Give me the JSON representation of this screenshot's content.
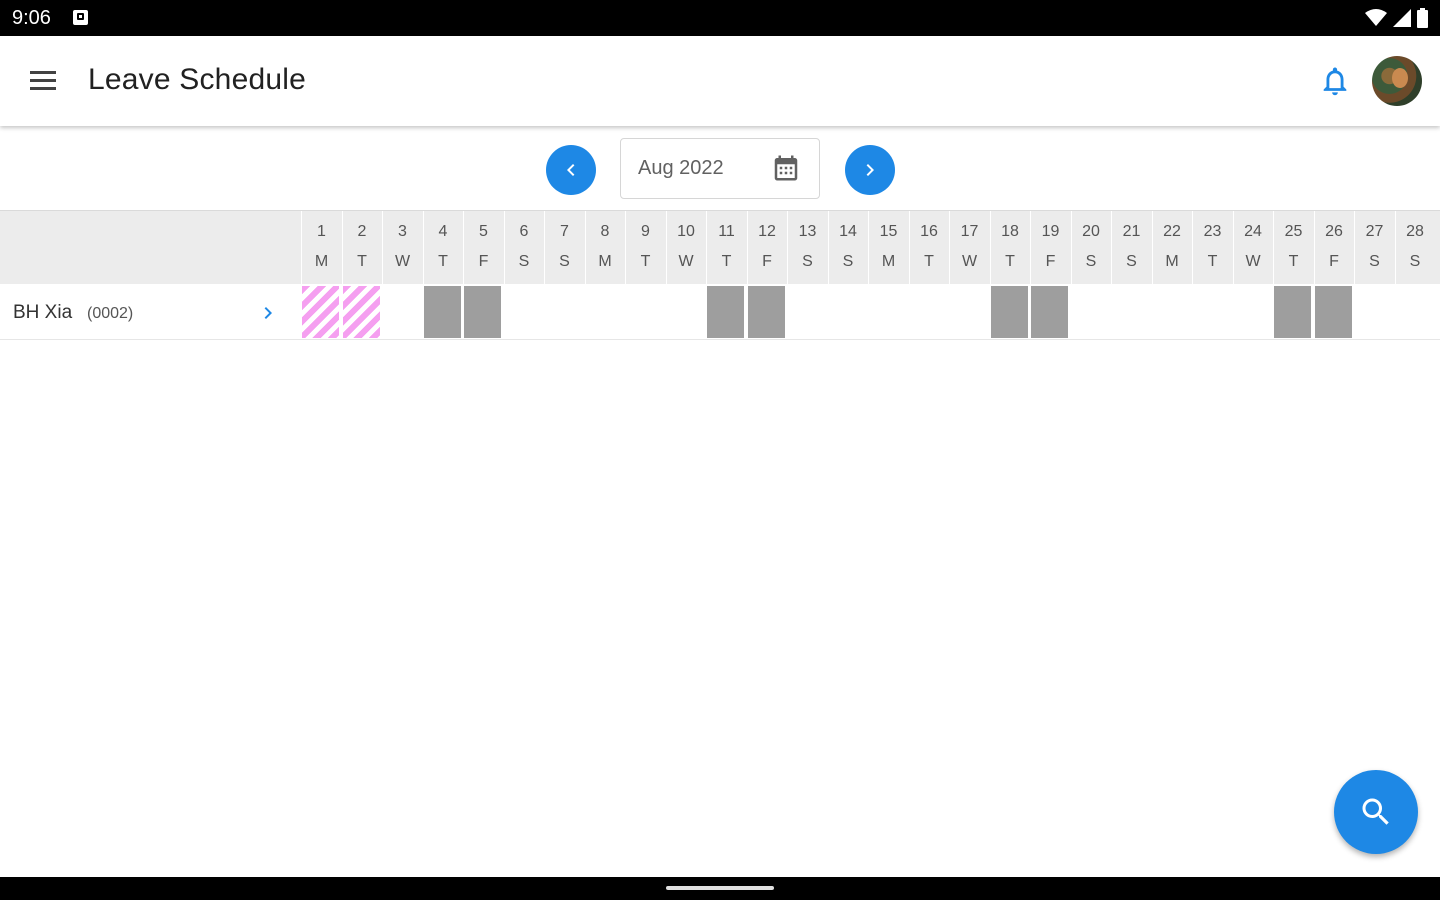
{
  "status_bar": {
    "time": "9:06",
    "icons": [
      "notification-icon",
      "wifi-icon",
      "signal-icon",
      "battery-icon"
    ]
  },
  "app_bar": {
    "title": "Leave Schedule",
    "menu_icon": "menu-icon",
    "bell_icon": "bell-icon",
    "accent": "#1e88e5"
  },
  "month_nav": {
    "label": "Aug 2022",
    "prev_icon": "chevron-left-icon",
    "next_icon": "chevron-right-icon",
    "calendar_icon": "calendar-icon"
  },
  "days": [
    {
      "num": "1",
      "dow": "M"
    },
    {
      "num": "2",
      "dow": "T"
    },
    {
      "num": "3",
      "dow": "W"
    },
    {
      "num": "4",
      "dow": "T"
    },
    {
      "num": "5",
      "dow": "F"
    },
    {
      "num": "6",
      "dow": "S"
    },
    {
      "num": "7",
      "dow": "S"
    },
    {
      "num": "8",
      "dow": "M"
    },
    {
      "num": "9",
      "dow": "T"
    },
    {
      "num": "10",
      "dow": "W"
    },
    {
      "num": "11",
      "dow": "T"
    },
    {
      "num": "12",
      "dow": "F"
    },
    {
      "num": "13",
      "dow": "S"
    },
    {
      "num": "14",
      "dow": "S"
    },
    {
      "num": "15",
      "dow": "M"
    },
    {
      "num": "16",
      "dow": "T"
    },
    {
      "num": "17",
      "dow": "W"
    },
    {
      "num": "18",
      "dow": "T"
    },
    {
      "num": "19",
      "dow": "F"
    },
    {
      "num": "20",
      "dow": "S"
    },
    {
      "num": "21",
      "dow": "S"
    },
    {
      "num": "22",
      "dow": "M"
    },
    {
      "num": "23",
      "dow": "T"
    },
    {
      "num": "24",
      "dow": "W"
    },
    {
      "num": "25",
      "dow": "T"
    },
    {
      "num": "26",
      "dow": "F"
    },
    {
      "num": "27",
      "dow": "S"
    },
    {
      "num": "28",
      "dow": "S"
    }
  ],
  "employees": [
    {
      "name": "BH Xia",
      "code": "(0002)",
      "leave_days": [
        1,
        2
      ],
      "off_days": [
        4,
        5,
        11,
        12,
        18,
        19,
        25,
        26
      ]
    }
  ],
  "colors": {
    "leave_stripe": "#f59ff0",
    "off_day": "#9e9e9e",
    "header_bg": "#ececec"
  },
  "fab": {
    "icon": "search-icon"
  }
}
